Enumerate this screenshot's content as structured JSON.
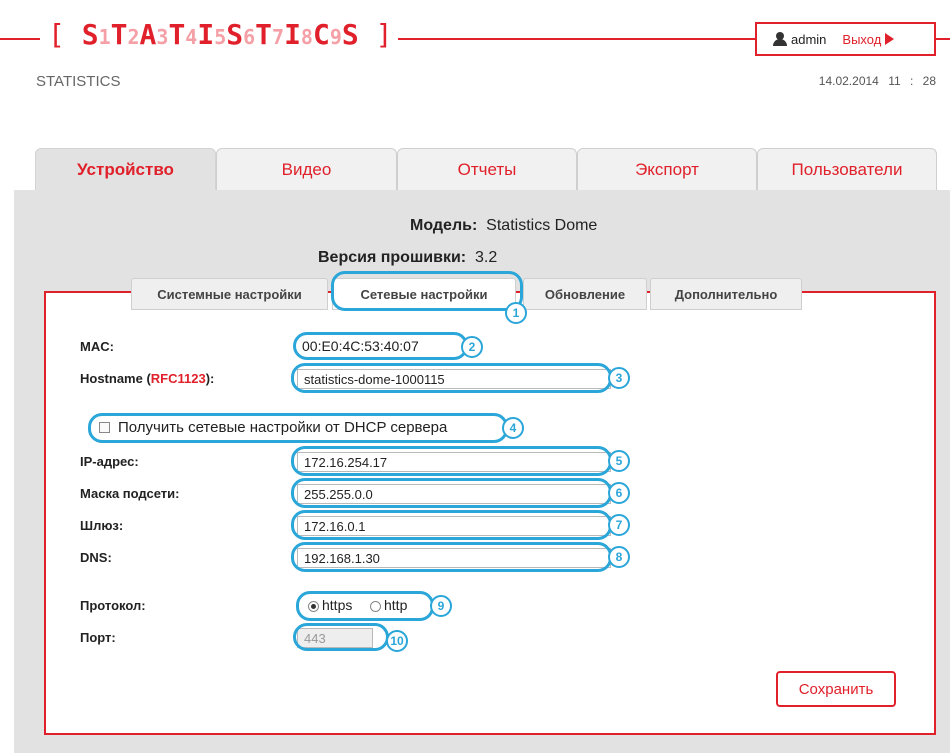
{
  "header": {
    "logo_segments": [
      {
        "t": "S",
        "n": false
      },
      {
        "t": "1",
        "n": true
      },
      {
        "t": "T",
        "n": false
      },
      {
        "t": "2",
        "n": true
      },
      {
        "t": "A",
        "n": false
      },
      {
        "t": "3",
        "n": true
      },
      {
        "t": "T",
        "n": false
      },
      {
        "t": "4",
        "n": true
      },
      {
        "t": "I",
        "n": false
      },
      {
        "t": "5",
        "n": true
      },
      {
        "t": "S",
        "n": false
      },
      {
        "t": "6",
        "n": true
      },
      {
        "t": "T",
        "n": false
      },
      {
        "t": "7",
        "n": true
      },
      {
        "t": "I",
        "n": false
      },
      {
        "t": "8",
        "n": true
      },
      {
        "t": "C",
        "n": false
      },
      {
        "t": "9",
        "n": true
      },
      {
        "t": "S",
        "n": false
      }
    ],
    "subtitle": "STATISTICS",
    "user": "admin",
    "logout_label": "Выход",
    "date": "14.02.2014",
    "time": "11 : 28"
  },
  "tabs": [
    {
      "label": "Устройство",
      "active": true
    },
    {
      "label": "Видео",
      "active": false
    },
    {
      "label": "Отчеты",
      "active": false
    },
    {
      "label": "Экспорт",
      "active": false
    },
    {
      "label": "Пользователи",
      "active": false
    }
  ],
  "device": {
    "model_label": "Модель:",
    "model_value": "Statistics Dome",
    "firmware_label": "Версия прошивки:",
    "firmware_value": "3.2"
  },
  "subtabs": [
    {
      "label": "Системные настройки",
      "active": false
    },
    {
      "label": "Сетевые настройки",
      "active": true
    },
    {
      "label": "Обновление",
      "active": false
    },
    {
      "label": "Дополнительно",
      "active": false
    }
  ],
  "form": {
    "mac_label": "MAC:",
    "mac_value": "00:E0:4C:53:40:07",
    "hostname_label": "Hostname (",
    "hostname_rfc": "RFC1123",
    "hostname_suffix": "):",
    "hostname_value": "statistics-dome-1000115",
    "dhcp_label": "Получить сетевые настройки от DHCP сервера",
    "dhcp_checked": false,
    "ip_label": "IP-адрес:",
    "ip_value": "172.16.254.17",
    "mask_label": "Маска подсети:",
    "mask_value": "255.255.0.0",
    "gateway_label": "Шлюз:",
    "gateway_value": "172.16.0.1",
    "dns_label": "DNS:",
    "dns_value": "192.168.1.30",
    "protocol_label": "Протокол:",
    "protocol_options": [
      "https",
      "http"
    ],
    "protocol_selected": "https",
    "port_label": "Порт:",
    "port_value": "443",
    "save_label": "Сохранить"
  },
  "callouts": [
    "1",
    "2",
    "3",
    "4",
    "5",
    "6",
    "7",
    "8",
    "9",
    "10"
  ],
  "colors": {
    "accent": "#e0202a",
    "callout": "#2aa6d9",
    "panel_bg": "#e2e2e2"
  }
}
